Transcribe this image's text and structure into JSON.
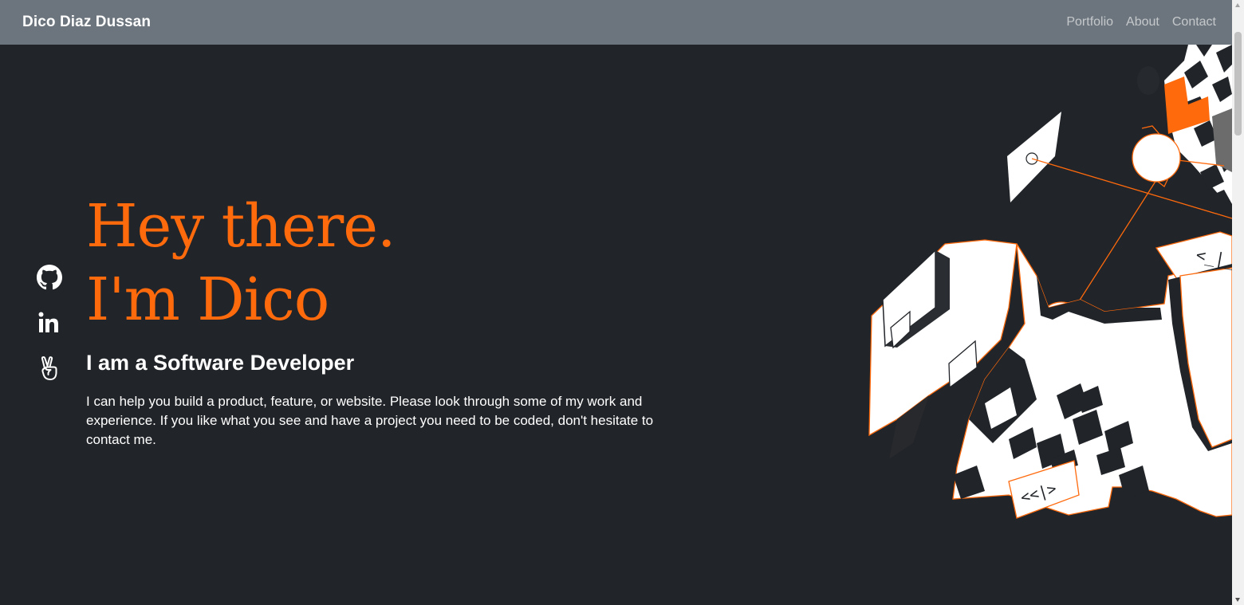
{
  "navbar": {
    "brand": "Dico Diaz Dussan",
    "links": [
      {
        "label": "Portfolio"
      },
      {
        "label": "About"
      },
      {
        "label": "Contact"
      }
    ]
  },
  "socials": [
    {
      "icon": "github-icon"
    },
    {
      "icon": "linkedin-icon"
    },
    {
      "icon": "angellist-icon"
    }
  ],
  "hero": {
    "line1": "Hey there.",
    "line2": "I'm Dico",
    "subtitle": "I am a Software Developer",
    "description": "I can help you build a product, feature, or website. Please look through some of my work and experience. If you like what you see and have a project you need to be coded, don't hesitate to contact me."
  },
  "illustration": {
    "code_tag_small": "<_|_",
    "code_tag_card": "<<|>"
  },
  "colors": {
    "accent": "#ff6a0d",
    "background": "#212428",
    "navbar": "#6c757d",
    "text": "#ffffff"
  }
}
